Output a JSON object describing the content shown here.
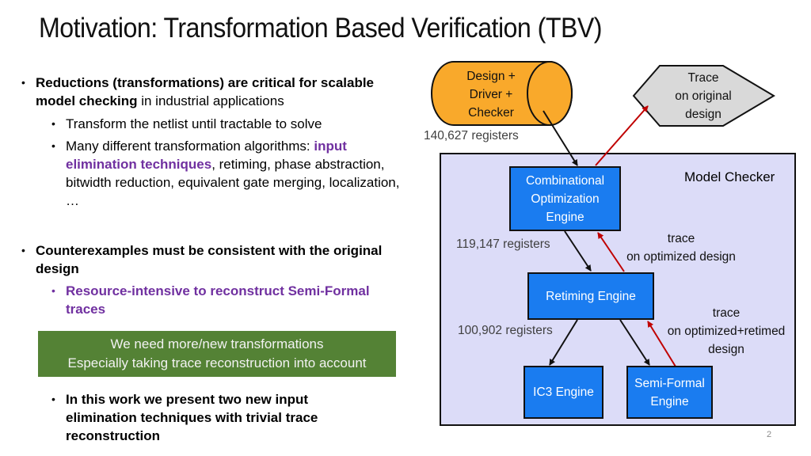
{
  "slide": {
    "title": "Motivation: Transformation Based Verification (TBV)",
    "page_number": "2"
  },
  "bullets": {
    "b1": {
      "bold": "Reductions (transformations) are critical for scalable model checking",
      "rest": " in industrial applications",
      "sub1": "Transform the netlist until tractable to solve",
      "sub2_pre": "Many different transformation algorithms: ",
      "sub2_highlight": "input elimination techniques",
      "sub2_post": ", retiming, phase abstraction, bitwidth reduction, equivalent gate merging, localization, …"
    },
    "b2": {
      "bold": "Counterexamples must be consistent with the original design",
      "sub1": "Resource-intensive to reconstruct Semi-Formal traces"
    },
    "callout": {
      "line1": "We need more/new transformations",
      "line2": "Especially taking trace reconstruction into account"
    },
    "b3": {
      "text": "In this work we present two new input elimination techniques with trivial trace reconstruction"
    },
    "bullet_glyph": "•"
  },
  "diagram": {
    "design_cylinder": {
      "line1": "Design +",
      "line2": "Driver +",
      "line3": "Checker"
    },
    "trace_hexagon": {
      "line1": "Trace",
      "line2": "on original",
      "line3": "design"
    },
    "model_checker_label": "Model Checker",
    "engines": {
      "combinational": {
        "line1": "Combinational",
        "line2": "Optimization",
        "line3": "Engine"
      },
      "retiming": "Retiming Engine",
      "ic3": "IC3 Engine",
      "semi_formal": {
        "line1": "Semi-Formal",
        "line2": "Engine"
      }
    },
    "registers": {
      "original": "140,627 registers",
      "optimized": "119,147 registers",
      "retimed": "100,902 registers"
    },
    "trace_labels": {
      "optimized": {
        "line1": "trace",
        "line2": "on optimized design"
      },
      "retimed": {
        "line1": "trace",
        "line2": "on optimized+retimed",
        "line3": "design"
      }
    },
    "colors": {
      "engine_fill": "#1a7cf0",
      "cylinder_fill": "#f9a92b",
      "hexagon_fill": "#d9d9d9",
      "model_checker_fill": "#dcdcf8",
      "trace_arrow": "#c00000",
      "callout_fill": "#548235",
      "highlight_text": "#7030a0"
    }
  }
}
